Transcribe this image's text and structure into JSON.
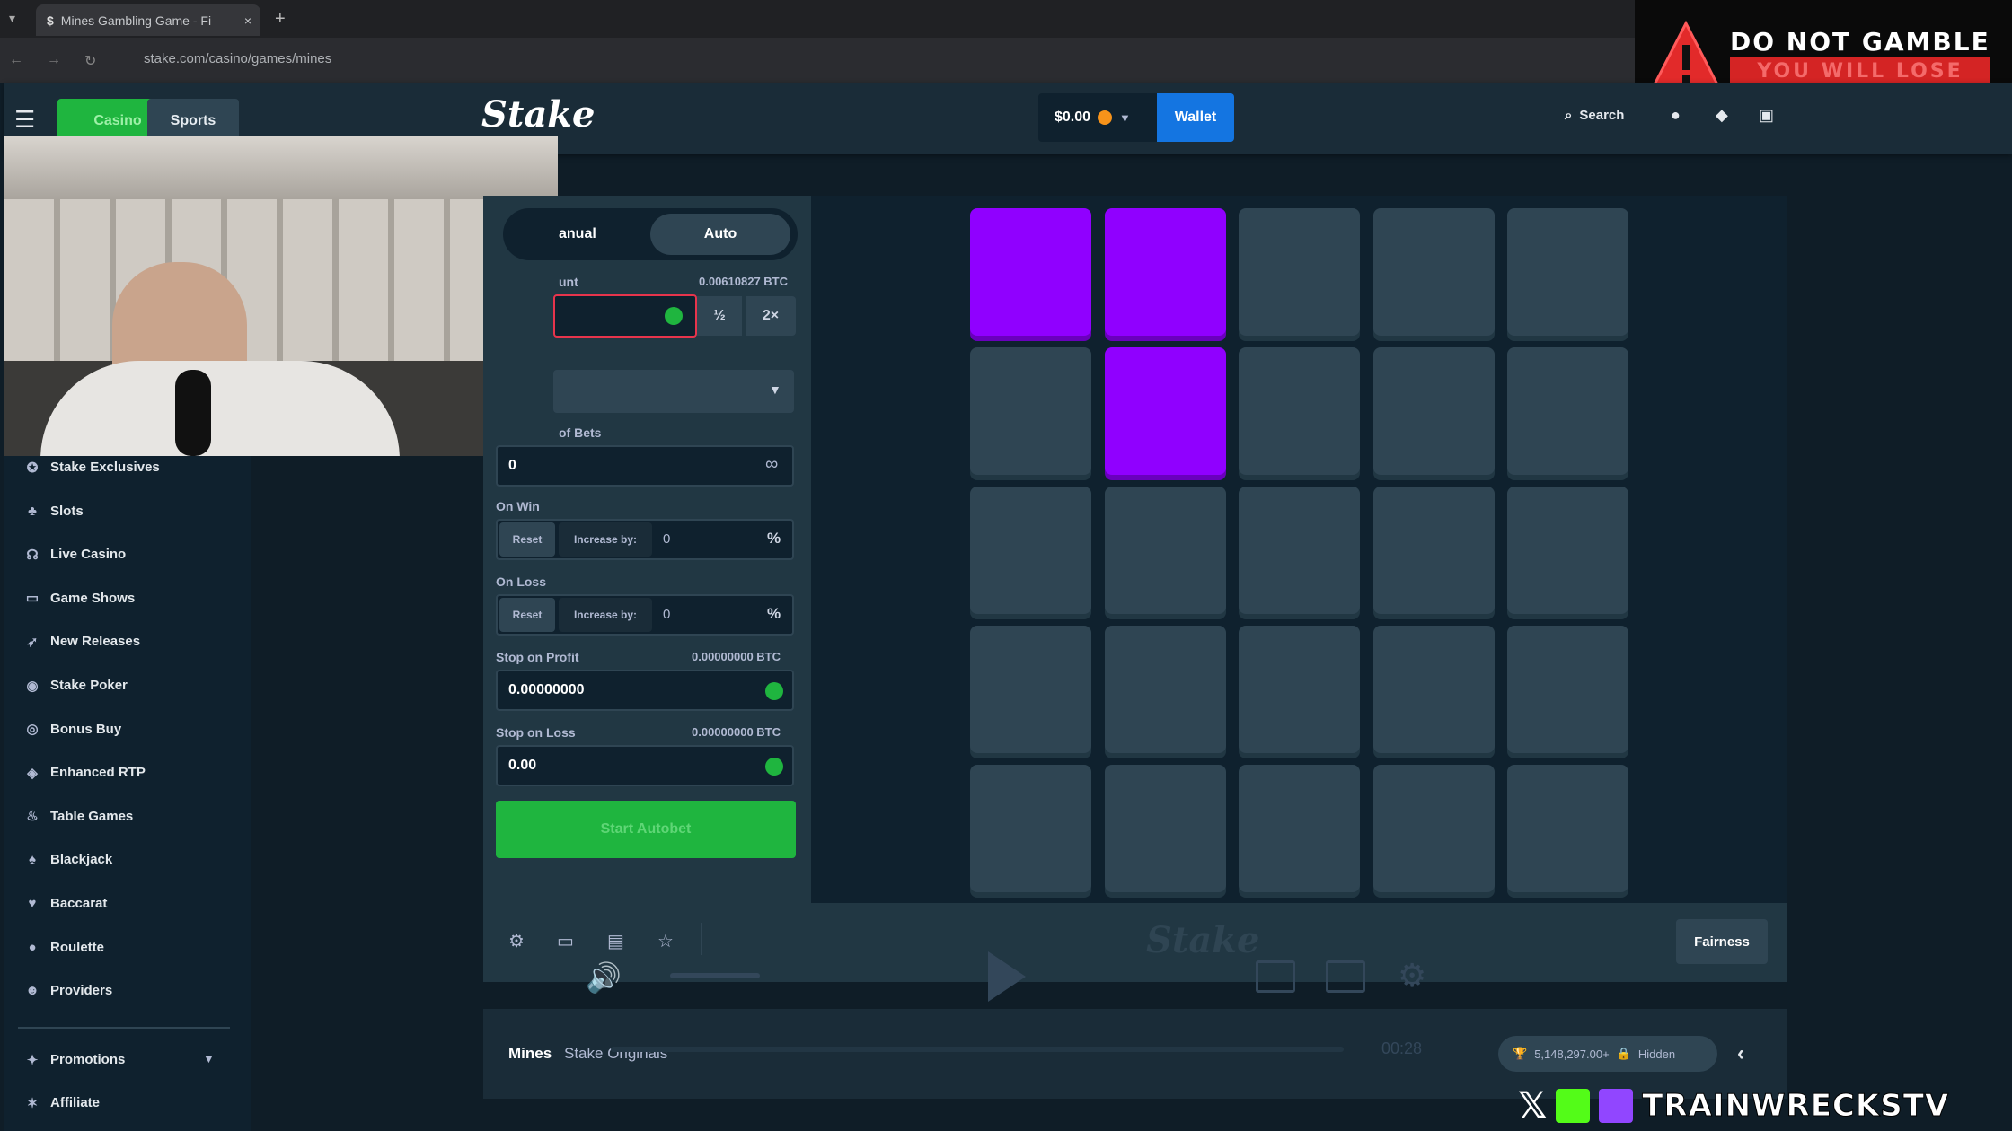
{
  "browser": {
    "tab_title": "Mines Gambling Game - Fi",
    "url": "stake.com/casino/games/mines"
  },
  "warning": {
    "line1": "DO NOT GAMBLE",
    "line2": "YOU WILL LOSE"
  },
  "header": {
    "logo": "Stake",
    "casino_tab": "Casino",
    "sports_tab": "Sports",
    "balance": "$0.00",
    "wallet": "Wallet",
    "search": "Search"
  },
  "sidebar": {
    "items": [
      {
        "label": "Stake Exclusives",
        "icon": "star-icon"
      },
      {
        "label": "Slots",
        "icon": "cherry-icon"
      },
      {
        "label": "Live Casino",
        "icon": "headset-icon"
      },
      {
        "label": "Game Shows",
        "icon": "tv-icon"
      },
      {
        "label": "New Releases",
        "icon": "rocket-icon"
      },
      {
        "label": "Stake Poker",
        "icon": "chip-icon"
      },
      {
        "label": "Bonus Buy",
        "icon": "coin-icon"
      },
      {
        "label": "Enhanced RTP",
        "icon": "tag-icon"
      },
      {
        "label": "Table Games",
        "icon": "flame-icon"
      },
      {
        "label": "Blackjack",
        "icon": "cards-icon"
      },
      {
        "label": "Baccarat",
        "icon": "heart-icon"
      },
      {
        "label": "Roulette",
        "icon": "ball-icon"
      },
      {
        "label": "Providers",
        "icon": "people-icon"
      }
    ],
    "promotions": "Promotions",
    "affiliate": "Affiliate"
  },
  "panel": {
    "tab_manual": "anual",
    "tab_auto": "Auto",
    "amount_label": "unt",
    "amount_btc": "0.00610827 BTC",
    "half": "½",
    "double": "2×",
    "bets_label": "of Bets",
    "bets_value": "0",
    "infinity": "∞",
    "on_win_label": "On Win",
    "on_loss_label": "On Loss",
    "reset": "Reset",
    "increase_by": "Increase by:",
    "increase_value": "0",
    "percent": "%",
    "stop_profit_label": "Stop on Profit",
    "stop_profit_btc": "0.00000000 BTC",
    "stop_profit_value": "0.00000000",
    "stop_loss_label": "Stop on Loss",
    "stop_loss_btc": "0.00000000 BTC",
    "stop_loss_value": "0.00",
    "start_button": "Start Autobet"
  },
  "board": {
    "gems": [
      [
        1,
        1,
        0,
        0,
        0
      ],
      [
        0,
        1,
        0,
        0,
        0
      ],
      [
        0,
        0,
        0,
        0,
        0
      ],
      [
        0,
        0,
        0,
        0,
        0
      ],
      [
        0,
        0,
        0,
        0,
        0
      ]
    ]
  },
  "footer": {
    "fairness": "Fairness",
    "game_name": "Mines",
    "game_provider": "Stake Originals",
    "wagered": "5,148,297.00+",
    "hidden": "Hidden",
    "time": "00:28"
  },
  "overlay": {
    "brand": "TRAINWRECKSTV"
  }
}
